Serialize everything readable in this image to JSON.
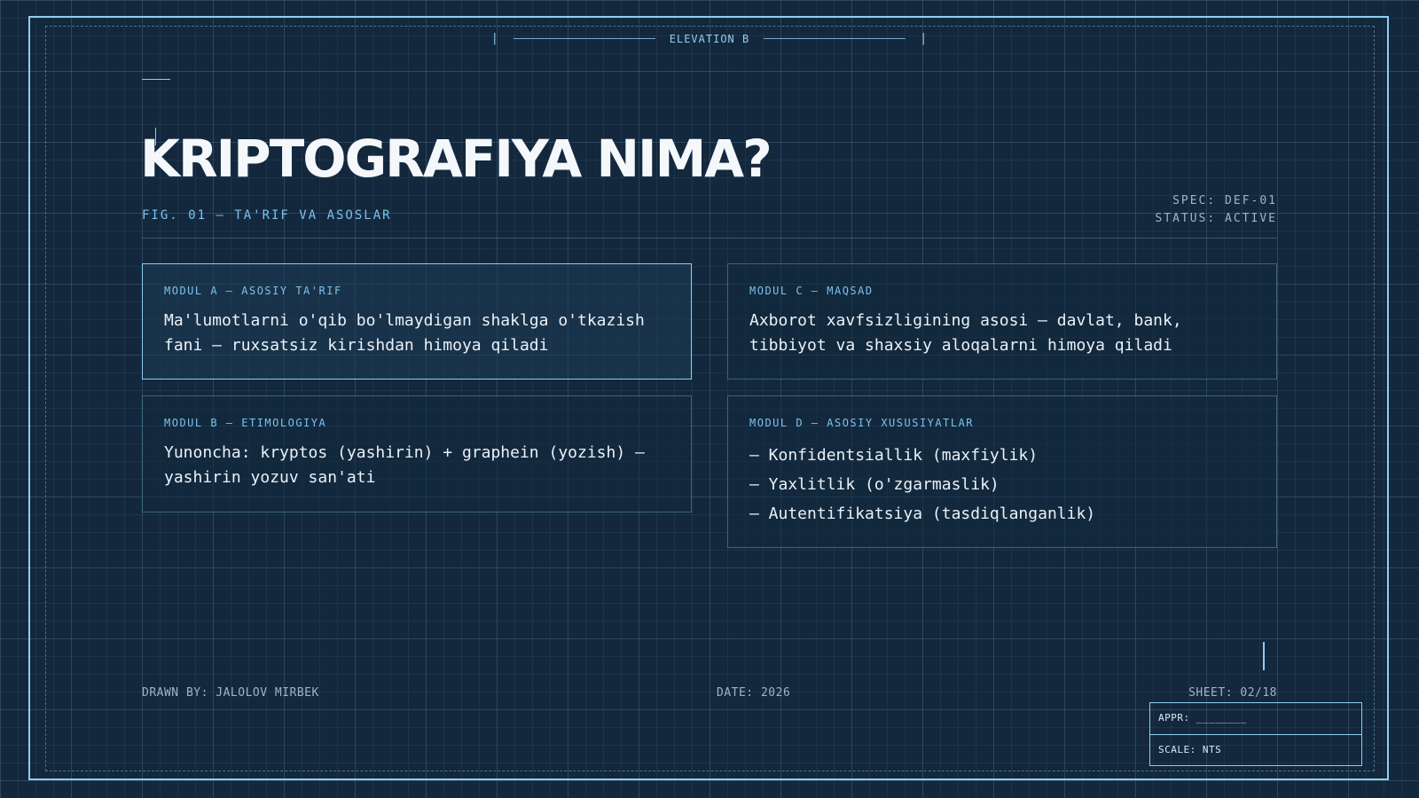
{
  "header": {
    "elevation_label": "ELEVATION B",
    "tick_left": "|",
    "tick_right": "|"
  },
  "title": "KRIPTOGRAFIYA NIMA?",
  "subtitle": "FIG. 01 — TA'RIF VA ASOSLAR",
  "spec": {
    "spec_line": "SPEC: DEF-01",
    "status_line": "STATUS: ACTIVE"
  },
  "modules": {
    "a": {
      "label": "MODUL A — ASOSIY TA'RIF",
      "body": "Ma'lumotlarni o'qib bo'lmaydigan shaklga o'tkazish fani — ruxsatsiz kirishdan himoya qiladi"
    },
    "b": {
      "label": "MODUL B — ETIMOLOGIYA",
      "body": "Yunoncha: kryptos (yashirin) + graphein (yozish) — yashirin yozuv san'ati"
    },
    "c": {
      "label": "MODUL C — MAQSAD",
      "body": "Axborot xavfsizligining asosi — davlat, bank, tibbiyot va shaxsiy aloqalarni himoya qiladi"
    },
    "d": {
      "label": "MODUL D — ASOSIY XUSUSIYATLAR",
      "items": [
        "— Konfidentsiallik (maxfiylik)",
        "— Yaxlitlik (o'zgarmaslik)",
        "— Autentifikatsiya (tasdiqlanganlik)"
      ]
    }
  },
  "footer": {
    "drawn_by": "DRAWN BY: JALOLOV MIRBEK",
    "date": "DATE: 2026",
    "sheet": "SHEET: 02/18"
  },
  "title_block": {
    "appr": "APPR: ________",
    "scale": "SCALE: NTS"
  },
  "colors": {
    "background": "#13283d",
    "accent": "#8fcdf0",
    "label": "#7cc2ee",
    "text": "#eaf1f7"
  }
}
